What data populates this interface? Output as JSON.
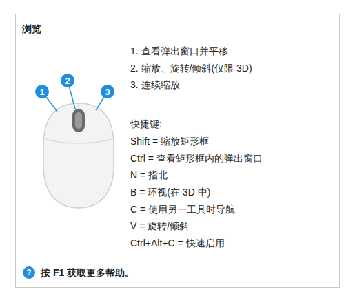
{
  "panel": {
    "title": "浏览"
  },
  "mouse": {
    "callouts": [
      "1",
      "2",
      "3"
    ]
  },
  "actions": [
    "1. 查看弹出窗口并平移",
    "2. 缩放、旋转/倾斜(仅限 3D)",
    "3. 连续缩放"
  ],
  "shortcuts": {
    "heading": "快捷键:",
    "items": [
      "Shift = 缩放矩形框",
      "Ctrl = 查看矩形框内的弹出窗口",
      "N = 指北",
      "B = 环视(在 3D 中)",
      "C = 使用另一工具时导航",
      "V = 旋转/倾斜",
      "Ctrl+Alt+C = 快速启用"
    ]
  },
  "help": {
    "icon": "?",
    "text": "按 F1 获取更多帮助。"
  }
}
